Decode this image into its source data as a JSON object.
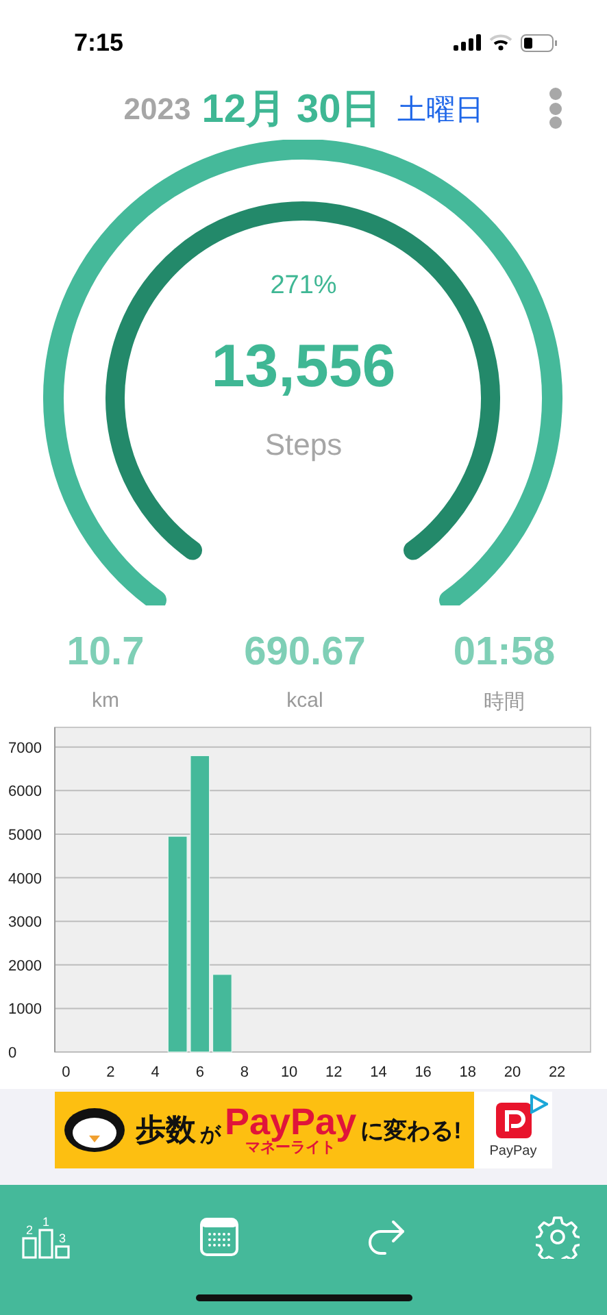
{
  "status_bar": {
    "time": "7:15"
  },
  "header": {
    "year": "2023",
    "date": "12月 30日",
    "weekday": "土曜日"
  },
  "gauge": {
    "percent": "271%",
    "steps": "13,556",
    "unit": "Steps"
  },
  "stats": [
    {
      "value": "10.7",
      "label": "km"
    },
    {
      "value": "690.67",
      "label": "kcal"
    },
    {
      "value": "01:58",
      "label": "時間"
    }
  ],
  "chart": {
    "chart_data": {
      "type": "bar",
      "grid": true,
      "x": [
        0,
        1,
        2,
        3,
        4,
        5,
        6,
        7,
        8,
        9,
        10,
        11,
        12,
        13,
        14,
        15,
        16,
        17,
        18,
        19,
        20,
        21,
        22,
        23
      ],
      "values": [
        0,
        0,
        0,
        0,
        0,
        4950,
        6800,
        1780,
        0,
        0,
        0,
        0,
        0,
        0,
        0,
        0,
        0,
        0,
        0,
        0,
        0,
        0,
        0,
        0
      ],
      "xlim": [
        -0.5,
        23.5
      ],
      "ylim": [
        0,
        7450
      ],
      "xticks": [
        0,
        2,
        4,
        6,
        8,
        10,
        12,
        14,
        16,
        18,
        20,
        22
      ],
      "yticks": [
        0,
        1000,
        2000,
        3000,
        4000,
        5000,
        6000,
        7000
      ]
    }
  },
  "ad": {
    "lead": "歩数",
    "particle": "が",
    "brand": "PayPay",
    "subtitle": "マネーライト",
    "tail": "に変わる!",
    "logo_label": "PayPay"
  },
  "nav": {
    "items": [
      {
        "kind": "ranking",
        "labels": [
          "2",
          "1",
          "3"
        ]
      },
      {
        "kind": "calendar"
      },
      {
        "kind": "share"
      },
      {
        "kind": "settings"
      }
    ]
  }
}
